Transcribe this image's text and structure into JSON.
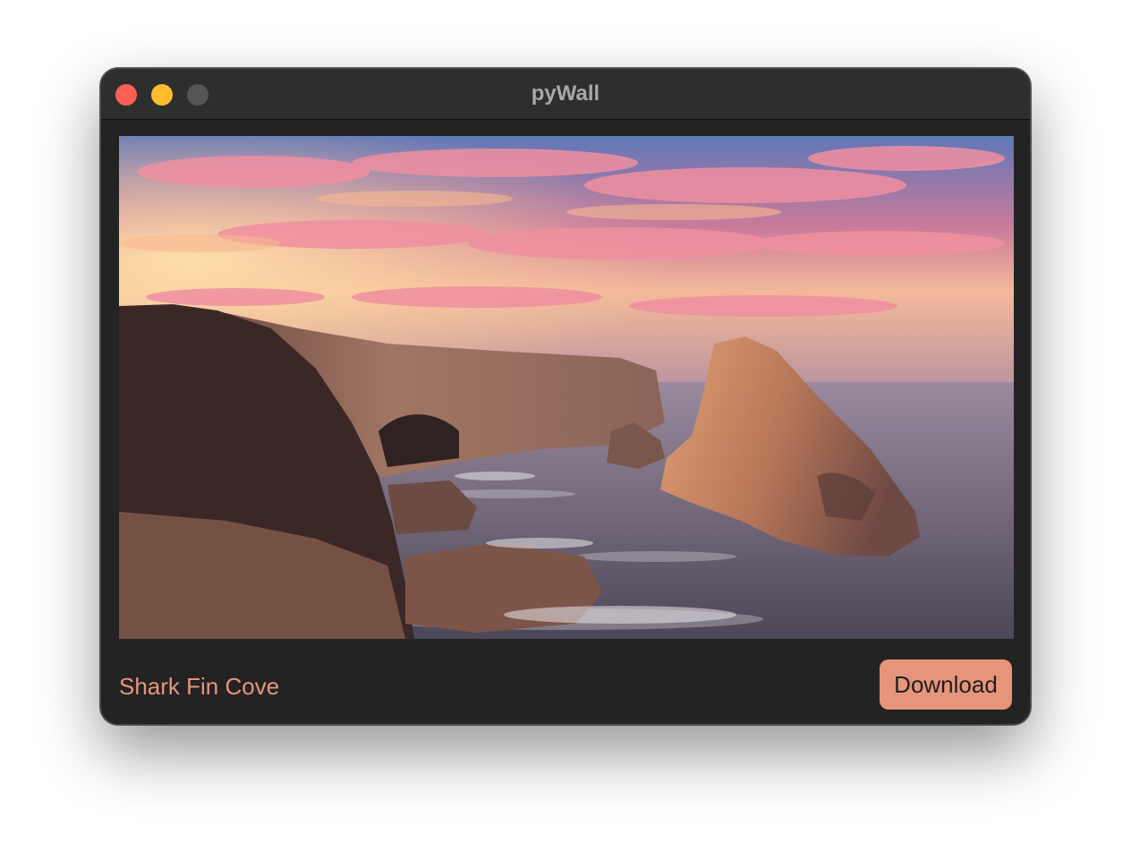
{
  "window": {
    "title": "pyWall"
  },
  "image": {
    "subject": "sunset-over-sea-cliffs-with-fin-shaped-rock"
  },
  "footer": {
    "caption": "Shark Fin Cove",
    "download_label": "Download"
  },
  "colors": {
    "accent": "#e6957b",
    "caption_text": "#e7957c",
    "window_bg": "#232323",
    "titlebar_bg": "#2e2e2e"
  }
}
